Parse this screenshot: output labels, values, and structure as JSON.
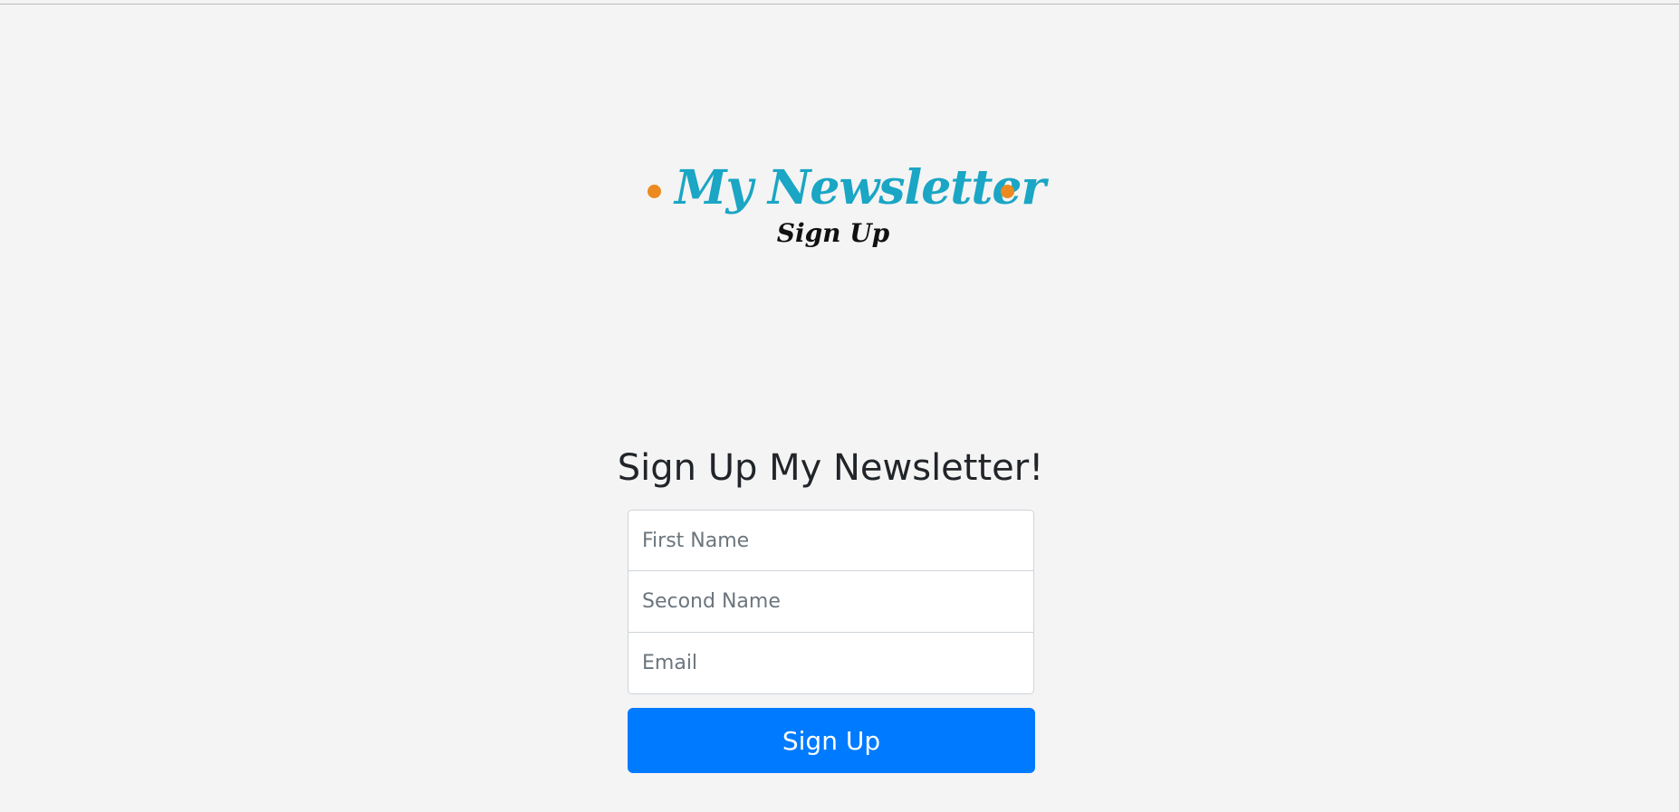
{
  "logo": {
    "title": "My Newsletter",
    "subtitle": "Sign Up"
  },
  "heading": "Sign Up My Newsletter!",
  "form": {
    "first_name": {
      "placeholder": "First Name",
      "value": ""
    },
    "second_name": {
      "placeholder": "Second Name",
      "value": ""
    },
    "email": {
      "placeholder": "Email",
      "value": ""
    },
    "submit_label": "Sign Up"
  },
  "colors": {
    "background": "#f4f4f4",
    "logo_title": "#1aa6c4",
    "logo_dot": "#ec8a1f",
    "button": "#007bff"
  }
}
